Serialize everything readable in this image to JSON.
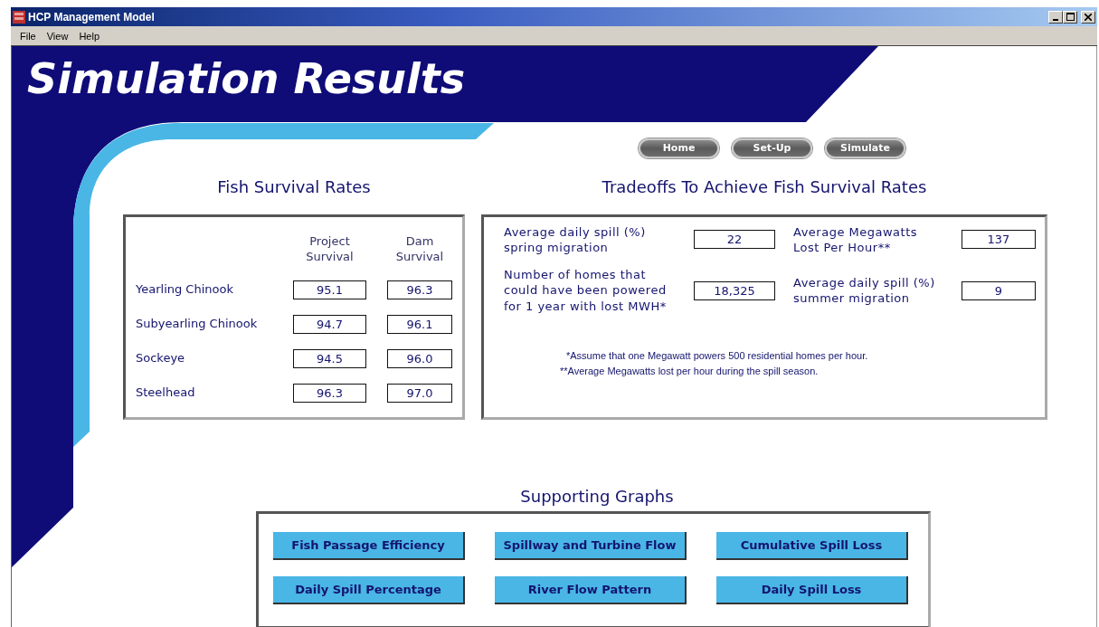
{
  "window": {
    "title": "HCP Management Model"
  },
  "menu": [
    "File",
    "View",
    "Help"
  ],
  "page_title": "Simulation Results",
  "nav_buttons": [
    "Home",
    "Set-Up",
    "Simulate"
  ],
  "survival": {
    "title": "Fish Survival Rates",
    "columns": [
      "Project\nSurvival",
      "Dam\nSurvival"
    ],
    "rows": [
      {
        "species": "Yearling Chinook",
        "project": "95.1",
        "dam": "96.3"
      },
      {
        "species": "Subyearling Chinook",
        "project": "94.7",
        "dam": "96.1"
      },
      {
        "species": "Sockeye",
        "project": "94.5",
        "dam": "96.0"
      },
      {
        "species": "Steelhead",
        "project": "96.3",
        "dam": "97.0"
      }
    ]
  },
  "tradeoffs": {
    "title": "Tradeoffs To Achieve Fish Survival Rates",
    "fields": [
      {
        "label": "Average daily spill (%)\nspring migration",
        "value": "22"
      },
      {
        "label": "Average Megawatts\nLost Per Hour**",
        "value": "137"
      },
      {
        "label": "Number of homes that\ncould have been powered\nfor 1 year with lost MWH*",
        "value": "18,325"
      },
      {
        "label": "Average daily spill (%)\nsummer migration",
        "value": "9"
      }
    ],
    "notes": [
      "*Assume that one Megawatt powers 500 residential homes per hour.",
      "**Average Megawatts lost per hour during the spill season."
    ]
  },
  "graphs": {
    "title": "Supporting Graphs",
    "buttons": [
      "Fish Passage Efficiency",
      "Spillway and Turbine Flow",
      "Cumulative Spill Loss",
      "Daily Spill Percentage",
      "River Flow Pattern",
      "Daily Spill Loss"
    ]
  }
}
